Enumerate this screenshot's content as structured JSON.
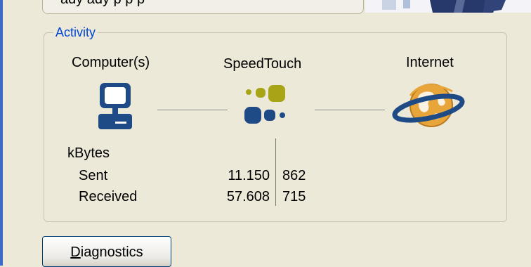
{
  "top_status": {
    "text": "ady    ady  p  p   p"
  },
  "activity": {
    "legend": "Activity",
    "nodes": {
      "computer": {
        "label": "Computer(s)",
        "icon": "computer-icon"
      },
      "speedtouch": {
        "label": "SpeedTouch",
        "icon": "speedtouch-logo-icon"
      },
      "internet": {
        "label": "Internet",
        "icon": "globe-ring-icon"
      }
    },
    "stats": {
      "unit_label": "kBytes",
      "sent_label": "Sent",
      "received_label": "Received",
      "sent_in": "11.150",
      "sent_out": "862",
      "received_in": "57.608",
      "received_out": "715"
    }
  },
  "buttons": {
    "diagnostics_mnemonic": "D",
    "diagnostics_rest": "iagnostics"
  },
  "colors": {
    "background": "#ECE9D8",
    "legend": "#0046D5",
    "computer_blue": "#1E4A86",
    "speedtouch_olive": "#A8A418",
    "globe_orange": "#E8A63A"
  }
}
